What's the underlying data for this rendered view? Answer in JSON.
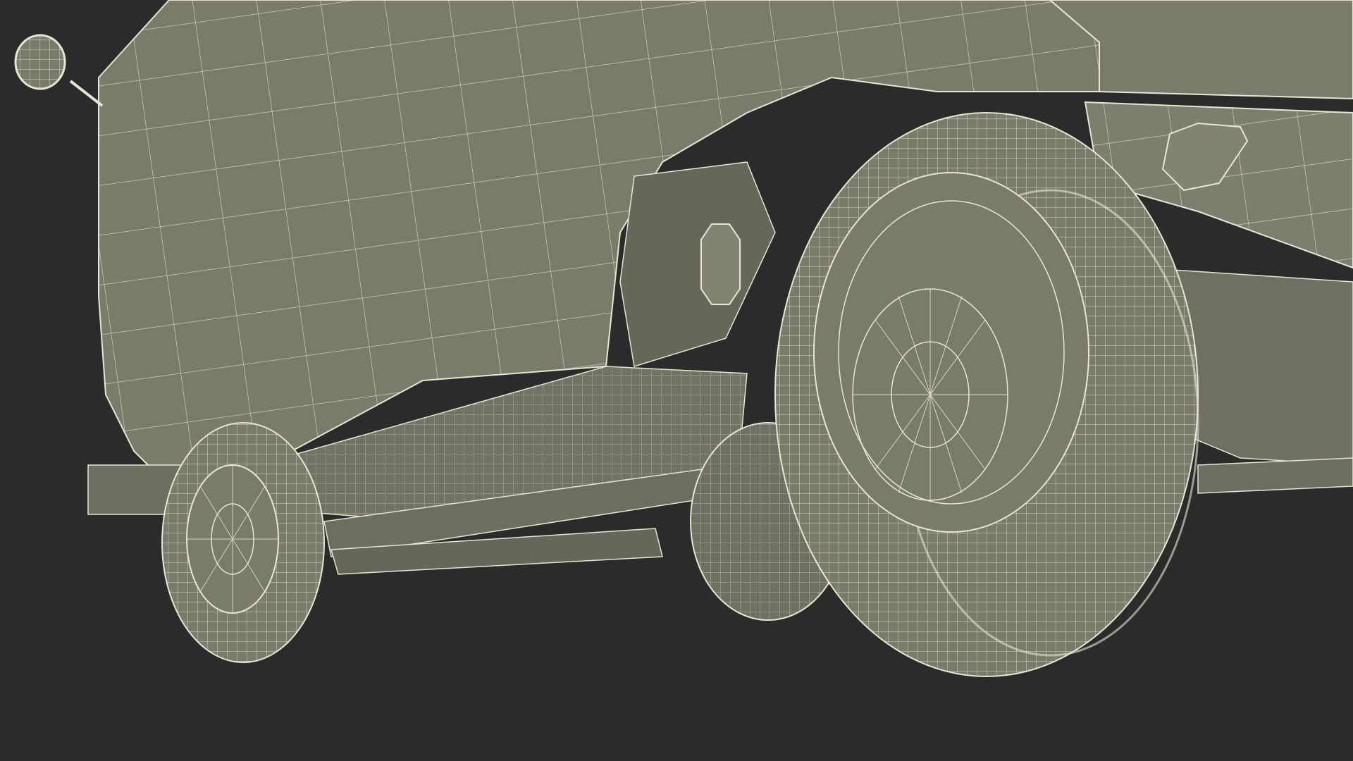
{
  "scene": {
    "background_color": "#2b2b2b",
    "surface_color": "#7b7b6c",
    "surface_shadow_color": "#66665a",
    "wire_color": "#e6e6d2",
    "subject": "vehicle-wireframe-render"
  }
}
